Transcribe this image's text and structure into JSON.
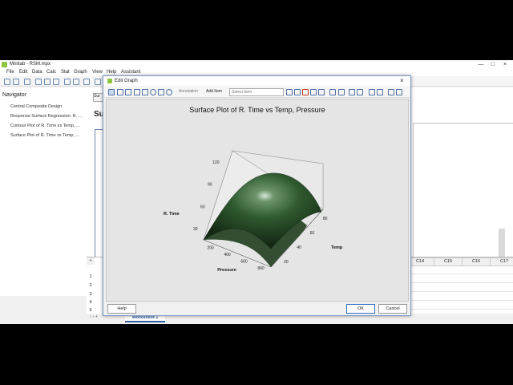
{
  "app": {
    "title": "Minitab - RSM.mpx",
    "window_buttons": [
      "—",
      "□",
      "×"
    ],
    "menu": [
      "File",
      "Edit",
      "Data",
      "Calc",
      "Stat",
      "Graph",
      "View",
      "Help",
      "Assistant"
    ]
  },
  "navigator": {
    "header": "Navigator",
    "items": [
      "Central Composite Design",
      "Response Surface Regression: R. ...",
      "Contour Plot of R. Time vs Temp, ...",
      "Surface Plot of R. Time vs Temp, ..."
    ]
  },
  "output": {
    "tab_label": "Sur",
    "title_fragment": "Su"
  },
  "worksheet": {
    "columns": [
      "C14",
      "C15",
      "C16",
      "C17"
    ],
    "rows": [
      "1",
      "2",
      "3",
      "4",
      "5"
    ],
    "tab": "Worksheet 1"
  },
  "dialog": {
    "title": "Edit Graph",
    "close": "×",
    "annotation_label": "Annotation",
    "add_item_label": "Add Item",
    "select_item_placeholder": "Select Item",
    "help_label": "Help",
    "ok_label": "OK",
    "cancel_label": "Cancel"
  },
  "chart_data": {
    "type": "surface",
    "title": "Surface Plot of R. Time vs Temp, Pressure",
    "zlabel": "R. Time",
    "xlabel": "Pressure",
    "ylabel": "Temp",
    "z_ticks": [
      30,
      60,
      90,
      120
    ],
    "x_ticks": [
      200,
      400,
      600,
      800
    ],
    "y_ticks": [
      20,
      40,
      60,
      80
    ],
    "surface_color": "#2f5a2f",
    "shape": "concave-down dome, maximum near center of Pressure/Temp range"
  }
}
